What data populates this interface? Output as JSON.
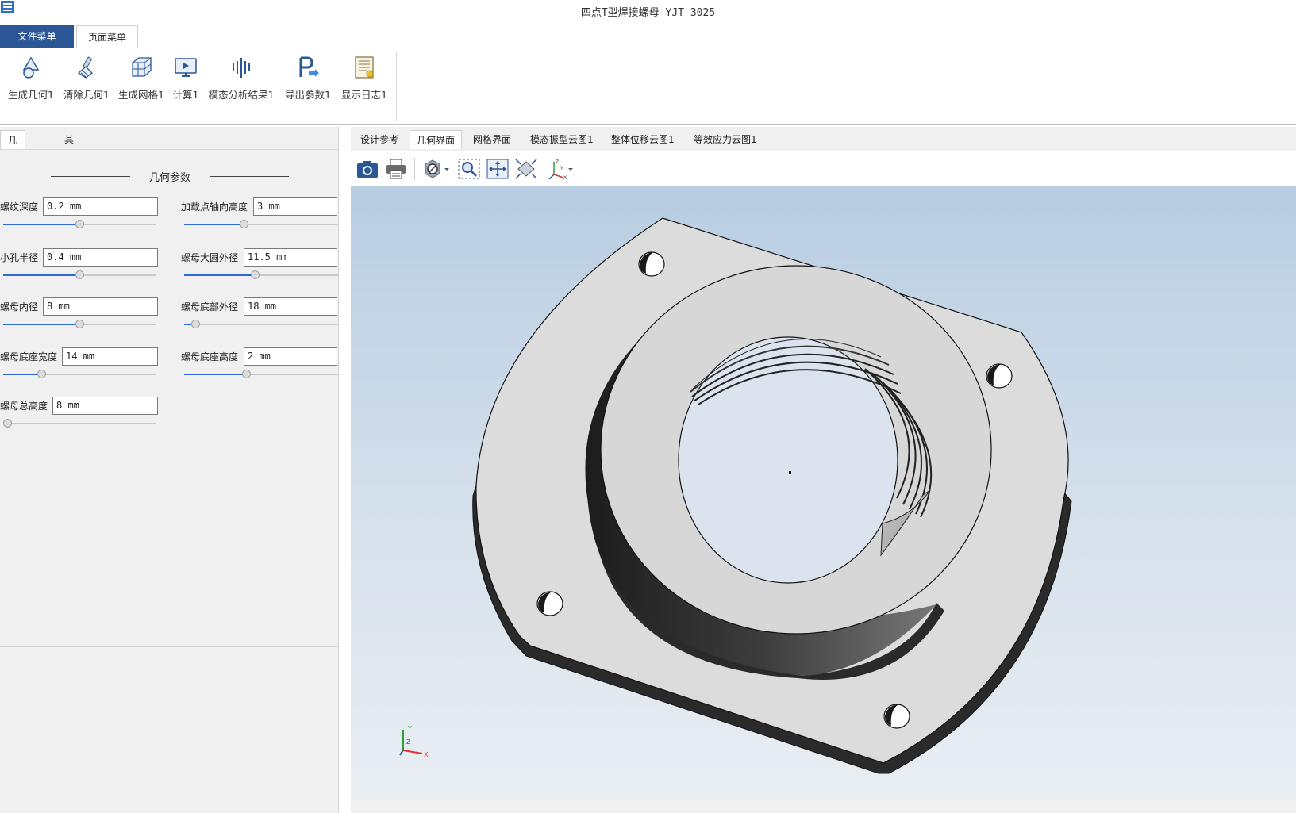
{
  "window": {
    "title": "四点T型焊接螺母-YJT-3025"
  },
  "menu_tabs": [
    {
      "label": "文件菜单"
    },
    {
      "label": "页面菜单"
    }
  ],
  "ribbon": {
    "buttons": [
      {
        "label": "生成几何1",
        "icon": "generate-geometry-icon"
      },
      {
        "label": "清除几何1",
        "icon": "clear-geometry-icon"
      },
      {
        "label": "生成网格1",
        "icon": "generate-mesh-icon"
      },
      {
        "label": "计算1",
        "icon": "compute-icon"
      },
      {
        "label": "模态分析结果1",
        "icon": "modal-analysis-icon"
      },
      {
        "label": "导出参数1",
        "icon": "export-params-icon"
      },
      {
        "label": "显示日志1",
        "icon": "show-log-icon"
      }
    ]
  },
  "left_tabs": [
    {
      "label": "几何参数"
    },
    {
      "label": "其他参数"
    }
  ],
  "param_group": {
    "title": "几何参数",
    "params": [
      {
        "label": "螺纹深度",
        "value": "0.2 mm",
        "slider": 0.5
      },
      {
        "label": "加载点轴向高度",
        "value": "3 mm",
        "slider": 0.38
      },
      {
        "label": "小孔半径",
        "value": "0.4 mm",
        "slider": 0.5
      },
      {
        "label": "螺母大圆外径",
        "value": "11.5 mm",
        "slider": 0.46
      },
      {
        "label": "螺母内径",
        "value": "8 mm",
        "slider": 0.5
      },
      {
        "label": "螺母底部外径",
        "value": "18 mm",
        "slider": 0.05
      },
      {
        "label": "螺母底座宽度",
        "value": "14 mm",
        "slider": 0.24
      },
      {
        "label": "螺母底座高度",
        "value": "2 mm",
        "slider": 0.4
      },
      {
        "label": "螺母总高度",
        "value": "8 mm",
        "slider": 0.0
      }
    ]
  },
  "view_tabs": [
    {
      "label": "设计参考"
    },
    {
      "label": "几何界面"
    },
    {
      "label": "网格界面"
    },
    {
      "label": "模态振型云图1"
    },
    {
      "label": "整体位移云图1"
    },
    {
      "label": "等效应力云图1"
    }
  ],
  "viewer_toolbar": [
    "camera-icon",
    "print-icon",
    "display-mode-icon",
    "zoom-window-icon",
    "pan-icon",
    "fit-all-icon",
    "axis-view-icon"
  ],
  "axis_triad": {
    "x": "X",
    "y": "Y",
    "z": "Z"
  },
  "colors": {
    "accent": "#2b5797",
    "viewport_top": "#b8cde2",
    "viewport_bottom": "#e9eef3",
    "slider_fill": "#2b6ad8"
  }
}
